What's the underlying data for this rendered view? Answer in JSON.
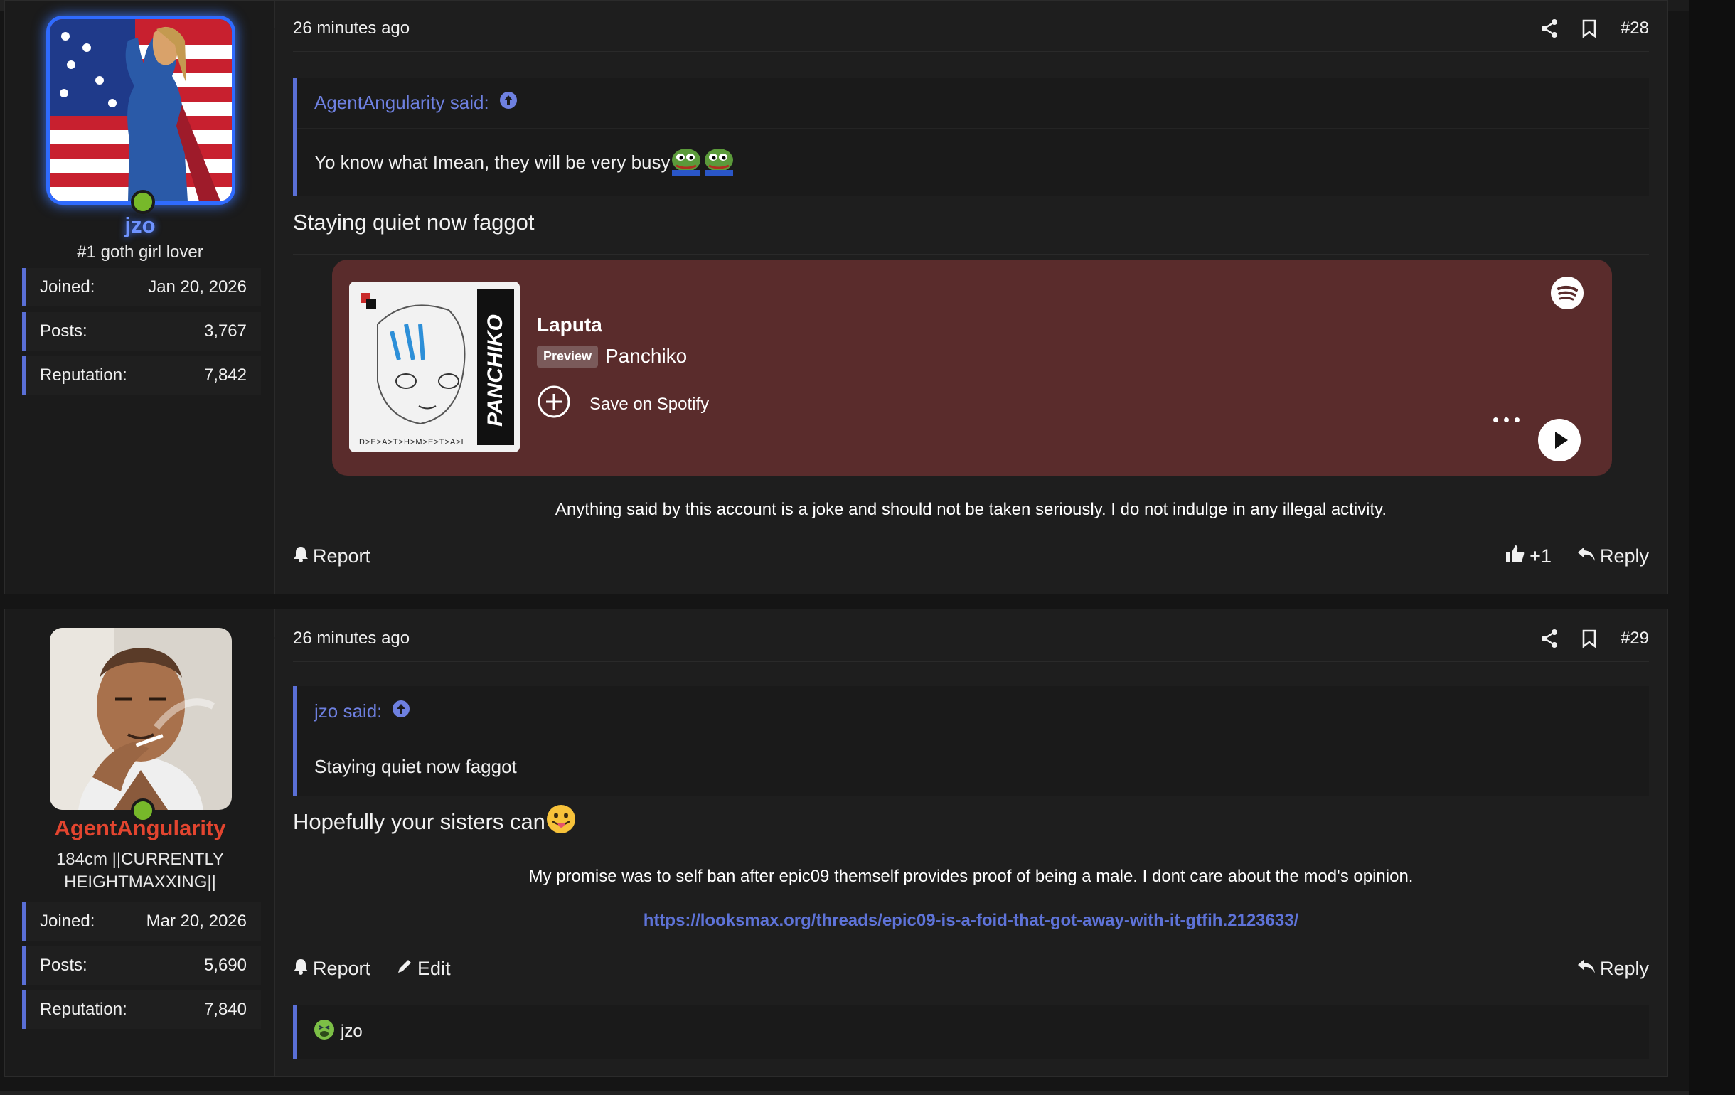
{
  "posts": [
    {
      "user": {
        "name": "jzo",
        "title": "#1 goth girl lover",
        "stats": [
          {
            "label": "Joined:",
            "value": "Jan 20, 2026"
          },
          {
            "label": "Posts:",
            "value": "3,767"
          },
          {
            "label": "Reputation:",
            "value": "7,842"
          }
        ]
      },
      "time": "26 minutes ago",
      "number": "#28",
      "quote": {
        "author": "AgentAngularity said:",
        "text": "Yo know what Imean, they will be very busy"
      },
      "text": "Staying quiet now faggot",
      "embed": {
        "track": "Laputa",
        "badge": "Preview",
        "artist": "Panchiko",
        "save": "Save on Spotify",
        "cover_text": "PANCHIKO",
        "cover_caption": "D>E>A>T>H>M>E>T>A>L"
      },
      "signature": "Anything said by this account is a joke and should not be taken seriously. I do not indulge in any illegal activity.",
      "actions": {
        "report": "Report",
        "like_count": "+1",
        "reply": "Reply"
      }
    },
    {
      "user": {
        "name": "AgentAngularity",
        "title": "184cm ||CURRENTLY HEIGHTMAXXING||",
        "stats": [
          {
            "label": "Joined:",
            "value": "Mar 20, 2026"
          },
          {
            "label": "Posts:",
            "value": "5,690"
          },
          {
            "label": "Reputation:",
            "value": "7,840"
          }
        ]
      },
      "time": "26 minutes ago",
      "number": "#29",
      "quote": {
        "author": "jzo said:",
        "text": "Staying quiet now faggot"
      },
      "text": "Hopefully your sisters can",
      "signature": "My promise was to self ban after epic09 themself provides proof of being a male. I dont care about the mod's opinion.",
      "signature_link": "https://looksmax.org/threads/epic09-is-a-foid-that-got-away-with-it-gtfih.2123633/",
      "actions": {
        "report": "Report",
        "edit": "Edit",
        "reply": "Reply"
      },
      "reaction_user": "jzo"
    }
  ],
  "colors": {
    "accent": "#5a6fd6",
    "online": "#77b82a",
    "spotify_bg": "#5a2c2c",
    "username_red": "#e3452f",
    "username_blue": "#6f93ff"
  }
}
